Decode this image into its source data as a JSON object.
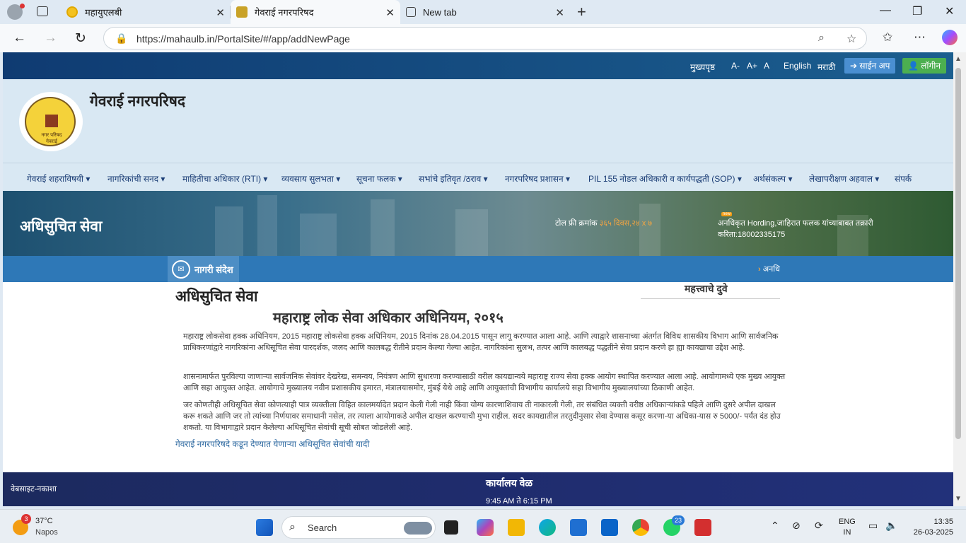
{
  "browser": {
    "tabs": [
      {
        "label": "महायुएलबी",
        "icon_color": "#f4c21f"
      },
      {
        "label": "गेवराई नगरपरिषद",
        "icon_color": "#c9a227"
      },
      {
        "label": "New tab",
        "icon_color": "#444444"
      }
    ],
    "url": "https://mahaulb.in/PortalSite/#/app/addNewPage"
  },
  "topbar": {
    "home": "मुख्यपृष्ठ",
    "font_minus": "A-",
    "font_plus": "A+",
    "font_normal": "A",
    "english": "English",
    "marathi": "मराठी",
    "signup": "साईन अप",
    "login": "लॉगीन",
    "signup_color": "#4a8fd1",
    "login_color": "#4caf50"
  },
  "header": {
    "title": "गेवराई नगरपरिषद",
    "logo_text": "नगर परिषद गेवराई"
  },
  "menu": [
    "गेवराई शहराविषयी ▾",
    "नागरिकांची सनद ▾",
    "माहितीचा अधिकार (RTI) ▾",
    "व्यवसाय सुलभता ▾",
    "सूचना फलक ▾",
    "सभांचे इतिवृत /ठराव ▾",
    "नगरपरिषद प्रशासन ▾",
    "PIL 155 नोडल अधिकारी व कार्यपद्धती (SOP) ▾",
    "अर्थसंकल्प ▾",
    "लेखापरीक्षण अहवाल ▾",
    "संपर्क"
  ],
  "banner": {
    "title": "अधिसुचित सेवा",
    "toll_label": "टोल फ्री क्रमांक",
    "toll_value": "३६५ दिवस,२४ x ७",
    "new_tag": "new",
    "hording": "अनधिकृत Hording,जाहिरात फलक यांच्याबाबत तक्रारी करिता:18002335175"
  },
  "news": {
    "label": "नागरी संदेश",
    "marquee": "अनधि"
  },
  "content": {
    "heading": "अधिसुचित सेवा",
    "subheading": "महाराष्ट्र लोक सेवा अधिकार अधिनियम, २०१५",
    "important_links": "महत्त्वाचे दुवे",
    "p1": "महाराष्ट्र लोकसेवा हक्क अधिनियम, 2015 महाराष्ट्र लोकसेवा हक्क अधिनियम, 2015 दिनांक 28.04.2015 पासून लागू करण्यात आला आहे. आणि त्याद्वारे शासनाच्या अंतर्गत विविध शासकीय विभाग आणि सार्वजनिक प्राधिकरणांद्वारे नागरिकांना अधिसूचित सेवा पारदर्शक, जलद आणि कालबद्ध रीतीने प्रदान केल्या गेल्या आहेत. नागरिकांना सुलभ, तत्पर आणि कालबद्ध पद्धतीने सेवा प्रदान करणे हा ह्या कायद्याचा उद्देश आहे.",
    "p2": "शासनामार्फत पुरविल्या जाणाऱ्या सार्वजनिक सेवांवर देखरेख, समन्वय, नियंत्रण आणि सुधारणा करण्यासाठी वरील कायद्यान्वये महाराष्ट्र राज्य सेवा हक्क आयोग स्थापित करण्यात आला आहे. आयोगामध्ये एक मुख्य आयुक्त आणि सहा आयुक्त आहेत. आयोगाचे मुख्यालय नवीन प्रशासकीय इमारत, मंत्रालयासमोर, मुंबई येथे आहे आणि आयुक्तांची विभागीय कार्यालये सहा विभागीय मुख्यालयांच्या ठिकाणी आहेत.",
    "p3": "जर कोणतीही अधिसूचित सेवा कोणत्याही पात्र व्यक्तीला विहित कालमर्यादेत प्रदान केली गेली नाही किंवा योग्य कारणाशिवाय ती नाकारली गेली, तर संबंधित व्यक्ती वरीष्ठ अधिकाऱ्यांकडे पहिले आणि दुसरे अपील दाखल करू शकते आणि जर तो त्यांच्या निर्णयावर समाधानी नसेल, तर त्याला आयोगाकडे अपील दाखल करण्याची मुभा राहील. सदर कायद्यातील तरतुदीनुसार सेवा देण्यास कसूर करणा-या अधिका-यास रु 5000/- पर्यंत दंड होउ शकतो. या विभागाद्वारे प्रदान केलेल्या अधिसूचित सेवांची सूची सोबत जोडलेली आहे.",
    "link": "गेवराई नगरपरिषदे कडून देण्यात येणाऱ्या अधिसूचित सेवांची यादी"
  },
  "footer": {
    "sitemap": "वेबसाइट-नकाशा",
    "office_title": "कार्यालय वेळ",
    "office_time": "9:45 AM ते 6:15 PM"
  },
  "taskbar": {
    "weather_temp": "37°C",
    "weather_city": "Napos",
    "weather_badge": "3",
    "search": "Search",
    "whatsapp_badge": "23",
    "lang1": "ENG",
    "lang2": "IN",
    "time": "13:35",
    "date": "26-03-2025"
  }
}
